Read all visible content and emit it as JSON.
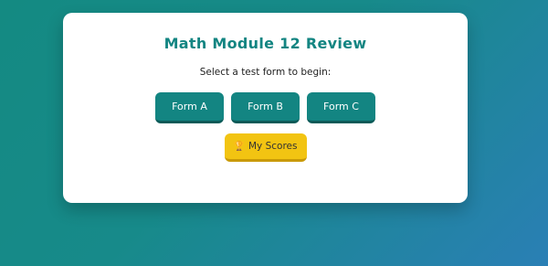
{
  "page": {
    "title": "Math Module 12 Review",
    "subtitle": "Select a test form to begin:"
  },
  "forms": [
    {
      "label": "Form A"
    },
    {
      "label": "Form B"
    },
    {
      "label": "Form C"
    }
  ],
  "scores_button": {
    "icon": "trophy-icon",
    "icon_glyph": "🏆",
    "label": "My Scores"
  },
  "colors": {
    "accent": "#138582",
    "scores": "#f2c412"
  }
}
